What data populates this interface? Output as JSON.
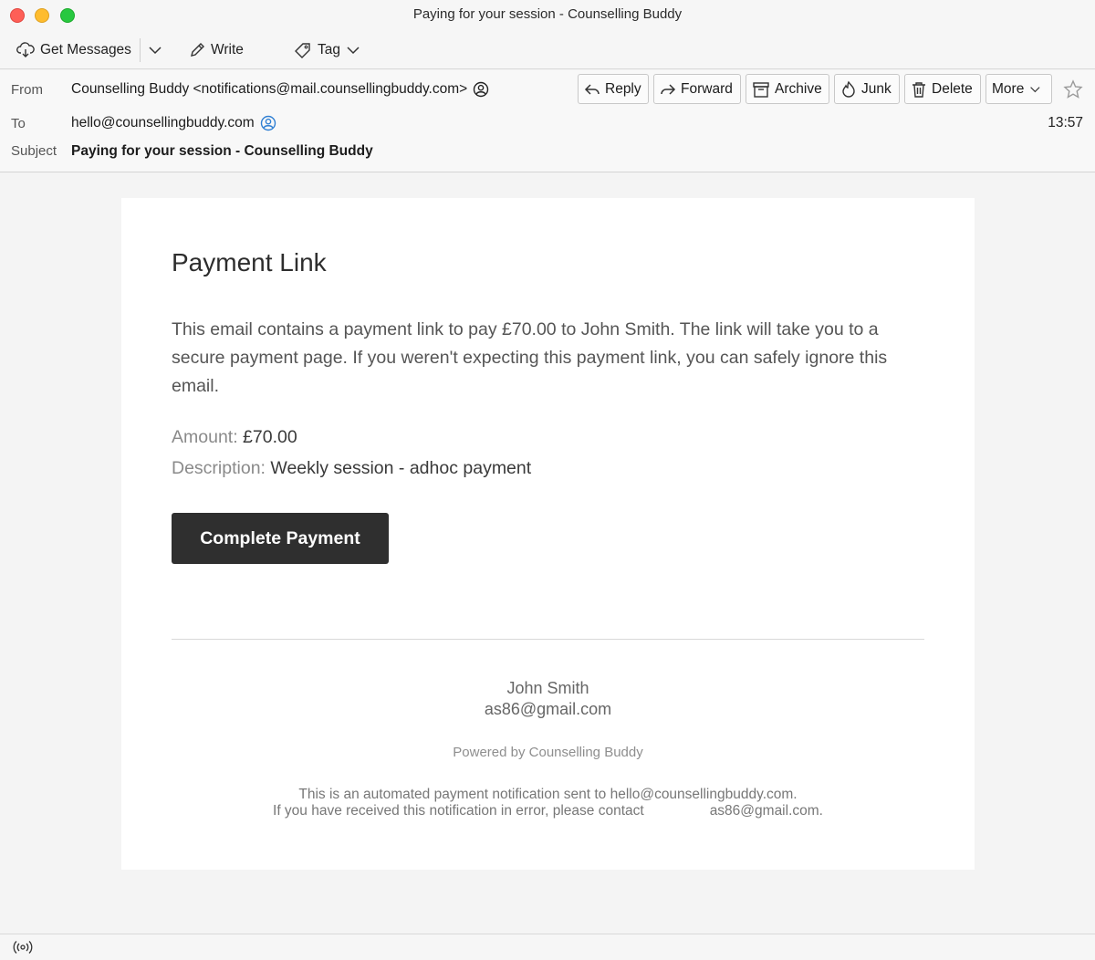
{
  "window": {
    "title": "Paying for your session - Counselling Buddy"
  },
  "toolbar": {
    "get_messages": "Get Messages",
    "write": "Write",
    "tag": "Tag"
  },
  "header": {
    "from_label": "From",
    "from_value": "Counselling Buddy <notifications@mail.counsellingbuddy.com>",
    "to_label": "To",
    "to_value": "hello@counsellingbuddy.com",
    "subject_label": "Subject",
    "subject_value": "Paying for your session - Counselling Buddy",
    "time": "13:57",
    "actions": {
      "reply": "Reply",
      "forward": "Forward",
      "archive": "Archive",
      "junk": "Junk",
      "delete": "Delete",
      "more": "More"
    }
  },
  "email": {
    "heading": "Payment Link",
    "paragraph": "This email contains a payment link to pay £70.00 to John Smith. The link will take you to a secure payment page. If you weren't expecting this payment link, you can safely ignore this email.",
    "amount_label": "Amount:",
    "amount_value": "£70.00",
    "description_label": "Description:",
    "description_value": "Weekly session - adhoc payment",
    "button": "Complete Payment",
    "footer": {
      "name": "John Smith",
      "email": "as86@gmail.com",
      "powered": "Powered by Counselling Buddy",
      "note_line1": "This is an automated payment notification sent to hello@counsellingbuddy.com.",
      "note_line2_a": "If you have received this notification in error, please contact",
      "note_line2_b": "as86@gmail.com."
    }
  },
  "colors": {
    "button_bg": "#2f2f2f",
    "close": "#fe5f57",
    "minimize": "#febc2e",
    "maximize": "#28c840",
    "contact_icon": "#2f7fd3"
  },
  "icons": [
    "get-messages-icon",
    "chevron-down-icon",
    "pencil-icon",
    "tag-icon",
    "reply-icon",
    "forward-icon",
    "archive-icon",
    "junk-icon",
    "trash-icon",
    "star-icon",
    "contact-icon",
    "address-book-icon",
    "online-status-icon"
  ]
}
